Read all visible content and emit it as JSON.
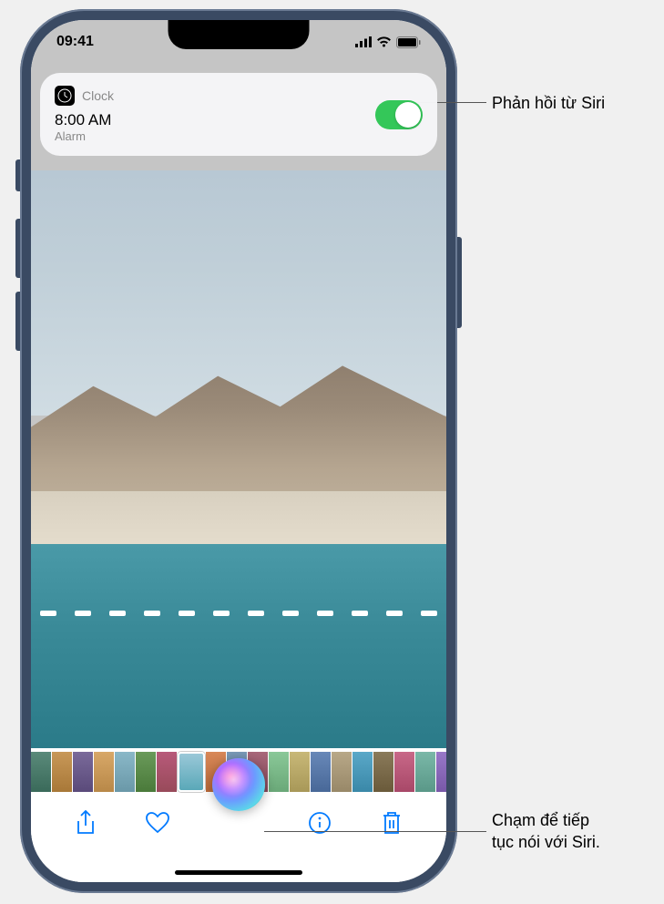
{
  "status_bar": {
    "time": "09:41"
  },
  "notification": {
    "app_name": "Clock",
    "time": "8:00 AM",
    "label": "Alarm"
  },
  "thumbnails": [
    {
      "bg": "linear-gradient(#5a8a7a,#3a6a5a)"
    },
    {
      "bg": "linear-gradient(#c89858,#a87838)"
    },
    {
      "bg": "linear-gradient(#7a6a9a,#5a4a7a)"
    },
    {
      "bg": "linear-gradient(#d8a868,#b88848)"
    },
    {
      "bg": "linear-gradient(#8ab8c8,#6a98a8)"
    },
    {
      "bg": "linear-gradient(#6a9a5a,#4a7a3a)"
    },
    {
      "bg": "linear-gradient(#b85a7a,#984a5a)"
    },
    {
      "bg": "linear-gradient(#9ac8d8,#5aa8b8)",
      "selected": true
    },
    {
      "bg": "linear-gradient(#d88858,#b86838)"
    },
    {
      "bg": "linear-gradient(#7a9ab8,#5a7a98)"
    },
    {
      "bg": "linear-gradient(#a8687a,#88485a)"
    },
    {
      "bg": "linear-gradient(#8ac898,#6aa878)"
    },
    {
      "bg": "linear-gradient(#c8b878,#a89858)"
    },
    {
      "bg": "linear-gradient(#6888b8,#486898)"
    },
    {
      "bg": "linear-gradient(#b8a888,#988868)"
    },
    {
      "bg": "linear-gradient(#5aa8c8,#3a88a8)"
    },
    {
      "bg": "linear-gradient(#8a7a5a,#6a5a3a)"
    },
    {
      "bg": "linear-gradient(#c86888,#a84868)"
    },
    {
      "bg": "linear-gradient(#7ab8a8,#5a9888)"
    },
    {
      "bg": "linear-gradient(#9878c8,#7858a8)"
    },
    {
      "bg": "linear-gradient(#d8c888,#b8a868)"
    }
  ],
  "callouts": {
    "siri_response": "Phản hồi từ Siri",
    "siri_continue": "Chạm để tiếp\ntục nói với Siri."
  }
}
